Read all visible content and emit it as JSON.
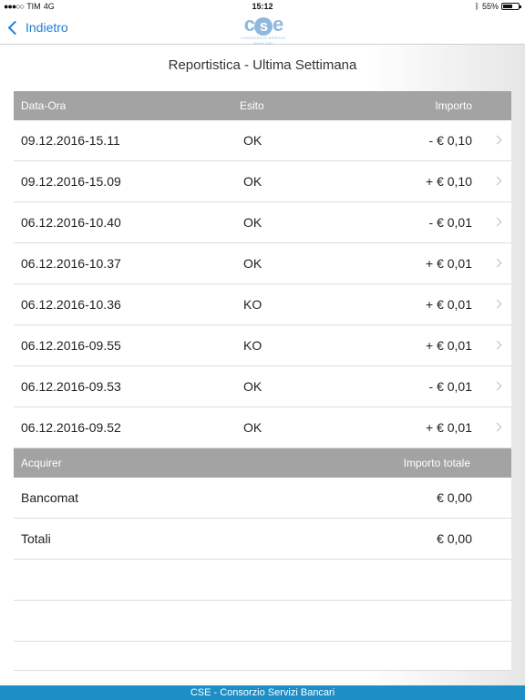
{
  "status": {
    "carrier": "TIM",
    "network": "4G",
    "time": "15:12",
    "battery": "55%"
  },
  "nav": {
    "back_label": "Indietro",
    "logo_text": "cse",
    "logo_sub": "CONSORZIO SERVIZI BANCARI"
  },
  "page": {
    "title": "Reportistica - Ultima Settimana"
  },
  "transactions": {
    "headers": {
      "date": "Data-Ora",
      "esito": "Esito",
      "importo": "Importo"
    },
    "rows": [
      {
        "date": "09.12.2016-15.11",
        "esito": "OK",
        "importo": "- € 0,10"
      },
      {
        "date": "09.12.2016-15.09",
        "esito": "OK",
        "importo": "+ € 0,10"
      },
      {
        "date": "06.12.2016-10.40",
        "esito": "OK",
        "importo": "- € 0,01"
      },
      {
        "date": "06.12.2016-10.37",
        "esito": "OK",
        "importo": "+ € 0,01"
      },
      {
        "date": "06.12.2016-10.36",
        "esito": "KO",
        "importo": "+ € 0,01"
      },
      {
        "date": "06.12.2016-09.55",
        "esito": "KO",
        "importo": "+ € 0,01"
      },
      {
        "date": "06.12.2016-09.53",
        "esito": "OK",
        "importo": "- € 0,01"
      },
      {
        "date": "06.12.2016-09.52",
        "esito": "OK",
        "importo": "+ € 0,01"
      }
    ]
  },
  "summary": {
    "headers": {
      "acquirer": "Acquirer",
      "totale": "Importo totale"
    },
    "rows": [
      {
        "name": "Bancomat",
        "value": "€ 0,00"
      },
      {
        "name": "Totali",
        "value": "€ 0,00"
      }
    ]
  },
  "footer": {
    "text": "CSE - Consorzio Servizi Bancari"
  },
  "colors": {
    "accent": "#1e7fd6",
    "header_bg": "#a3a3a3",
    "footer_bg": "#1d8fc7"
  }
}
